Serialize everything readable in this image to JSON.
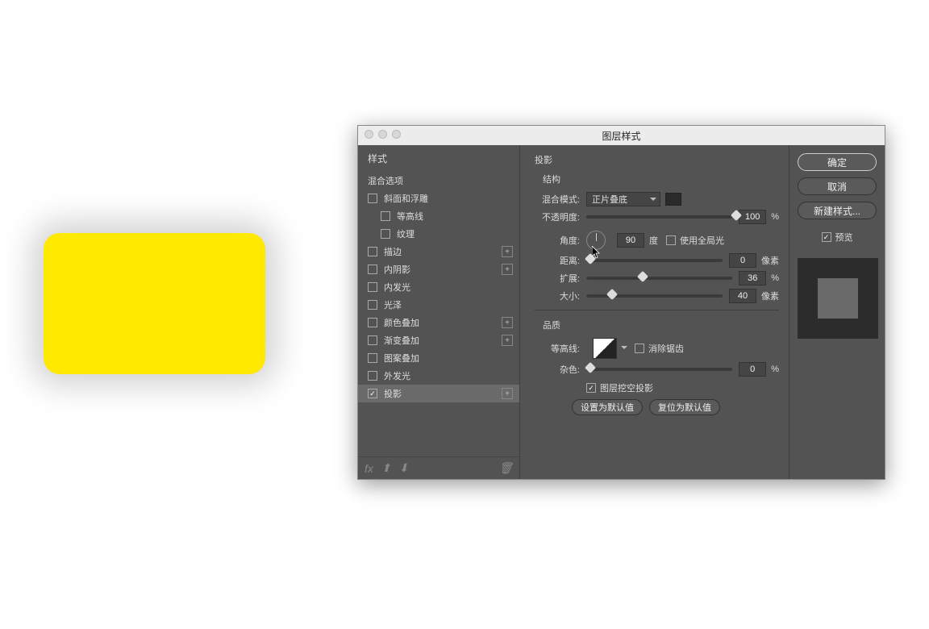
{
  "dialog_title": "图层样式",
  "sidebar": {
    "header": "样式",
    "blending": "混合选项",
    "items": [
      {
        "label": "斜面和浮雕",
        "checked": false,
        "plus": false
      },
      {
        "label": "等高线",
        "checked": false,
        "plus": false,
        "indent": true
      },
      {
        "label": "纹理",
        "checked": false,
        "plus": false,
        "indent": true
      },
      {
        "label": "描边",
        "checked": false,
        "plus": true
      },
      {
        "label": "内阴影",
        "checked": false,
        "plus": true
      },
      {
        "label": "内发光",
        "checked": false,
        "plus": false
      },
      {
        "label": "光泽",
        "checked": false,
        "plus": false
      },
      {
        "label": "颜色叠加",
        "checked": false,
        "plus": true
      },
      {
        "label": "渐变叠加",
        "checked": false,
        "plus": true
      },
      {
        "label": "图案叠加",
        "checked": false,
        "plus": false
      },
      {
        "label": "外发光",
        "checked": false,
        "plus": false
      },
      {
        "label": "投影",
        "checked": true,
        "plus": true,
        "selected": true
      }
    ],
    "footer_fx": "fx"
  },
  "main": {
    "title": "投影",
    "structure": "结构",
    "blend_mode_label": "混合模式:",
    "blend_mode_value": "正片叠底",
    "opacity_label": "不透明度:",
    "opacity_value": "100",
    "opacity_unit": "%",
    "angle_label": "角度:",
    "angle_value": "90",
    "angle_unit": "度",
    "global_light": "使用全局光",
    "distance_label": "距离:",
    "distance_value": "0",
    "distance_unit": "像素",
    "spread_label": "扩展:",
    "spread_value": "36",
    "spread_unit": "%",
    "size_label": "大小:",
    "size_value": "40",
    "size_unit": "像素",
    "quality": "品质",
    "contour_label": "等高线:",
    "antialias": "消除锯齿",
    "noise_label": "杂色:",
    "noise_value": "0",
    "noise_unit": "%",
    "knockout": "图层挖空投影",
    "make_default": "设置为默认值",
    "reset_default": "复位为默认值"
  },
  "right": {
    "ok": "确定",
    "cancel": "取消",
    "new_style": "新建样式...",
    "preview": "预览"
  }
}
